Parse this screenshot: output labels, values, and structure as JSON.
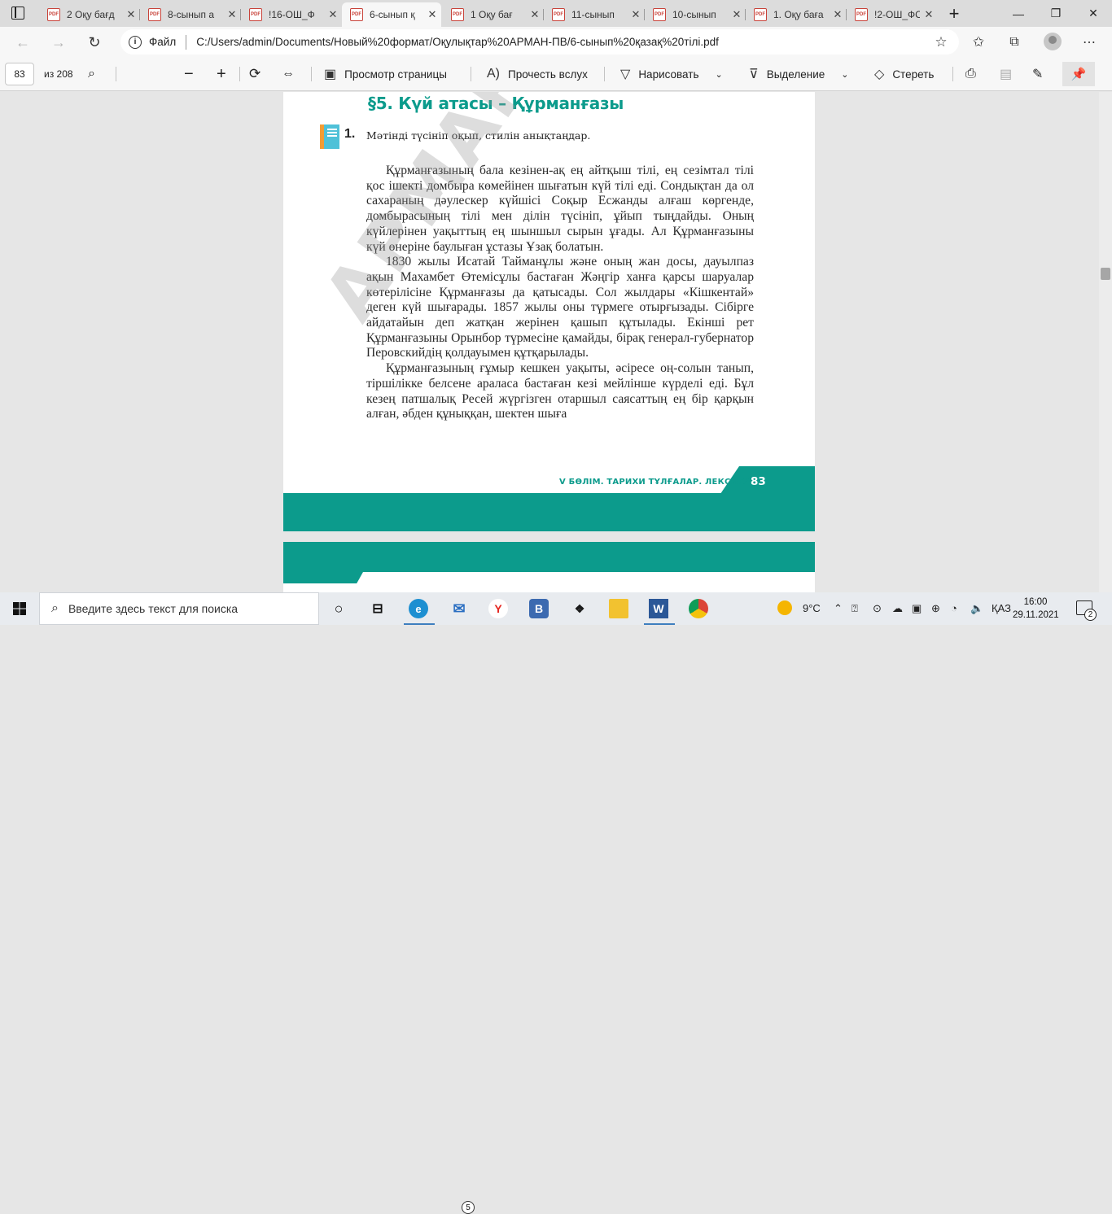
{
  "browser": {
    "tabs": [
      {
        "title": "2 Оқу бағд",
        "active": false
      },
      {
        "title": "8-сынып а",
        "active": false
      },
      {
        "title": "!16-ОШ_Ф",
        "active": false
      },
      {
        "title": "6-сынып қ",
        "active": true
      },
      {
        "title": "1 Оқу бағ",
        "active": false
      },
      {
        "title": "11-сынып",
        "active": false
      },
      {
        "title": "10-сынып",
        "active": false
      },
      {
        "title": "1. Оқу баға",
        "active": false
      },
      {
        "title": "!2-ОШ_ФС",
        "active": false
      }
    ],
    "new_tab": "+",
    "address": {
      "file_label": "Файл",
      "url": "C:/Users/admin/Documents/Новый%20формат/Оқулықтар%20АРМАН-ПВ/6-сынып%20қазақ%20тілі.pdf"
    }
  },
  "pdf_toolbar": {
    "page_number": "83",
    "page_total": "из 208",
    "view_page": "Просмотр страницы",
    "read_aloud": "Прочесть вслух",
    "draw": "Нарисовать",
    "highlight": "Выделение",
    "erase": "Стереть"
  },
  "document": {
    "heading": "§5. Күй атасы – Құрманғазы",
    "exercise_number": "1.",
    "exercise_text": "Мәтінді түсініп оқып, стилін анықтаңдар.",
    "paragraphs": [
      "Құрманғазының бала кезінен-ақ ең айтқыш тілі, ең сезімтал тілі қос ішекті домбыра көмейінен шығатын күй тілі еді. Сондықтан да ол сахараның дәулескер күйшісі Соқыр Есжанды алғаш көргенде, домбырасының тілі мен ділін түсініп, ұйып тыңдайды. Оның күйлерінен уақыттың ең шыншыл сырын ұғады. Ал Құрманғазыны күй өнеріне баулыған ұстазы Ұзақ болатын.",
      "1830 жылы Исатай Тайманұлы және оның жан досы, дауылпаз ақын Махамбет Өтемісұлы бастаған Жәңгір ханға қарсы шаруалар көтерілісіне Құрманғазы да қатысады. Сол жылдары «Кішкентай» деген күй шығарады. 1857 жылы оны түрмеге отырғызады. Сібірге айдатайын деп жатқан жерінен қашып құтылады. Екінші рет Құрманғазыны Орынбор түрмесіне қамайды, бірақ генерал-губернатор Перовскийдің қолдауымен құтқарылады.",
      "Құрманғазының ғұмыр кешкен уақыты, әсіресе оң-солын танып, тіршілікке белсене араласа бастаған кезі мейлінше күрделі еді. Бұл кезең патшалық Ресей жүргізген отаршыл саясаттың ең бір қарқын алған, әбден құныққан, шектен шыға"
    ],
    "watermark": "АРМАН-ПВ",
    "footer_label": "V БӨЛІМ. ТАРИХИ ТҰЛҒАЛАР. ЛЕКСИКА",
    "footer_page": "83"
  },
  "taskbar": {
    "search_placeholder": "Введите здесь текст для поиска",
    "mail_badge": "5",
    "weather": "9°C",
    "language": "ҚАЗ",
    "time": "16:00",
    "date": "29.11.2021",
    "notifications": "2"
  },
  "colors": {
    "teal": "#0c9b8c",
    "accent_orange": "#f39c34"
  }
}
